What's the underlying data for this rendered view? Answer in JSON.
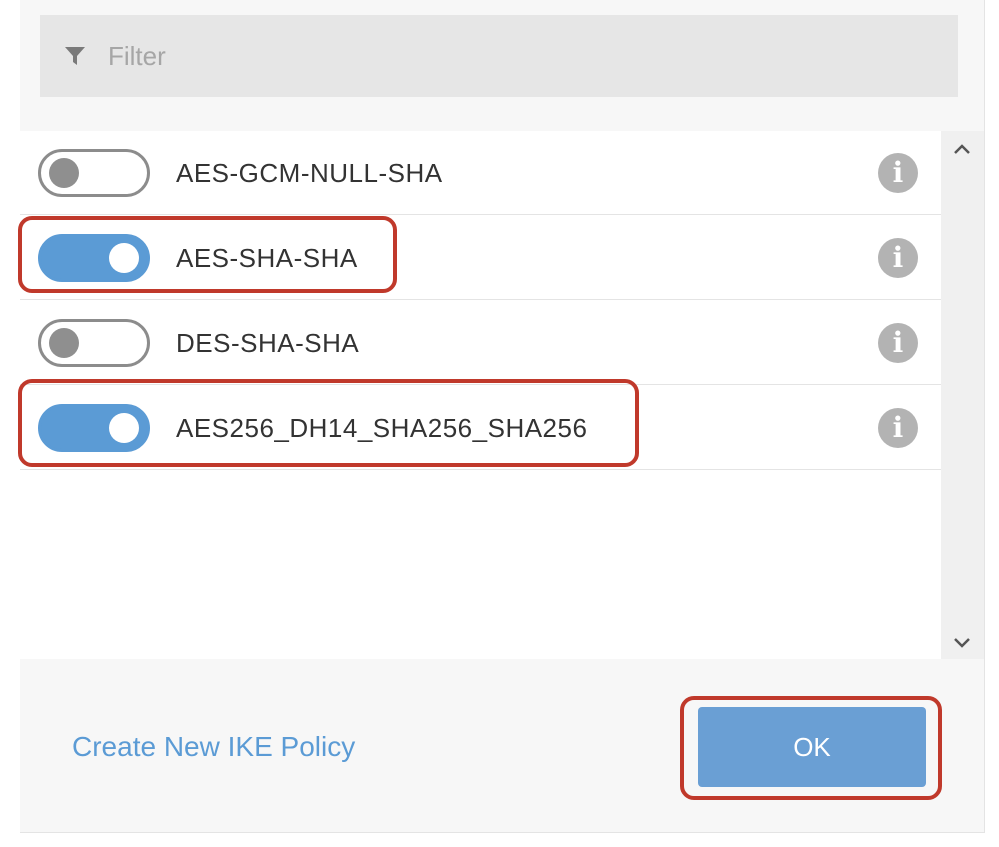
{
  "filter": {
    "placeholder": "Filter",
    "icon": "filter-icon"
  },
  "policies": [
    {
      "label": "AES-GCM-NULL-SHA",
      "enabled": false,
      "highlighted": false
    },
    {
      "label": "AES-SHA-SHA",
      "enabled": true,
      "highlighted": true
    },
    {
      "label": "DES-SHA-SHA",
      "enabled": false,
      "highlighted": false
    },
    {
      "label": "AES256_DH14_SHA256_SHA256",
      "enabled": true,
      "highlighted": true
    }
  ],
  "info_icon": {
    "glyph": "i",
    "icon": "info-icon"
  },
  "footer": {
    "create_link": "Create New IKE Policy",
    "ok_label": "OK",
    "ok_highlighted": true
  },
  "colors": {
    "accent": "#5b9bd5",
    "toggle_off": "#8c8c8c",
    "highlight": "#c0392b",
    "info_icon": "#b3b3b3"
  }
}
